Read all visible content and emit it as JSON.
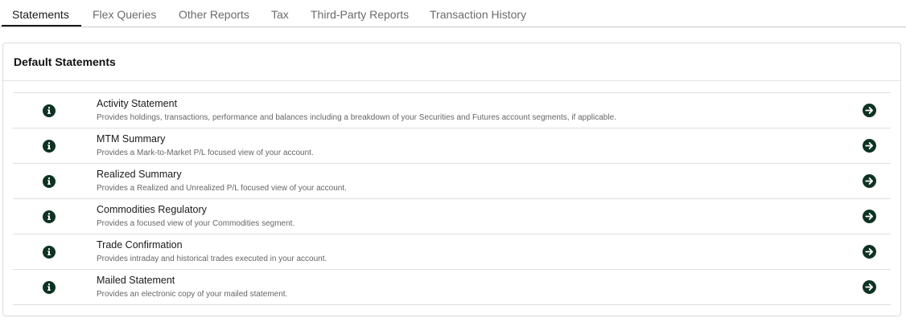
{
  "tabs": [
    {
      "label": "Statements",
      "active": true
    },
    {
      "label": "Flex Queries",
      "active": false
    },
    {
      "label": "Other Reports",
      "active": false
    },
    {
      "label": "Tax",
      "active": false
    },
    {
      "label": "Third-Party Reports",
      "active": false
    },
    {
      "label": "Transaction History",
      "active": false
    }
  ],
  "panel": {
    "title": "Default Statements"
  },
  "statements": [
    {
      "title": "Activity Statement",
      "description": "Provides holdings, transactions, performance and balances including a breakdown of your Securities and Futures account segments, if applicable."
    },
    {
      "title": "MTM Summary",
      "description": "Provides a Mark-to-Market P/L focused view of your account."
    },
    {
      "title": "Realized Summary",
      "description": "Provides a Realized and Unrealized P/L focused view of your account."
    },
    {
      "title": "Commodities Regulatory",
      "description": "Provides a focused view of your Commodities segment."
    },
    {
      "title": "Trade Confirmation",
      "description": "Provides intraday and historical trades executed in your account."
    },
    {
      "title": "Mailed Statement",
      "description": "Provides an electronic copy of your mailed statement."
    }
  ],
  "icons": {
    "info": "info-icon",
    "run": "arrow-right-circle-icon"
  },
  "colors": {
    "icon_fill": "#0f3323",
    "active_tab": "#1a1a1a",
    "inactive_tab": "#6b6b6b"
  }
}
